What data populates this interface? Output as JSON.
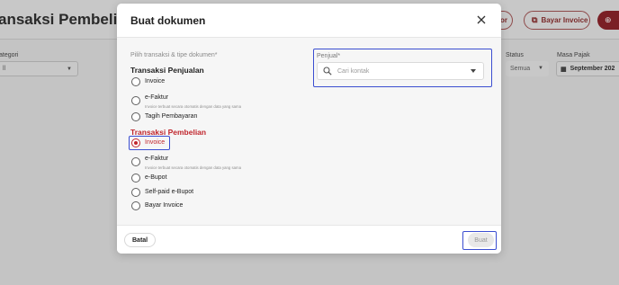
{
  "background": {
    "page_title": "ansaksi Pembelian",
    "header_buttons": {
      "partial_label": "or",
      "bayar_invoice_label": "Bayar Invoice"
    },
    "filters": {
      "kategori_label": "ategori",
      "kategori_value": "ll",
      "status_label": "Status",
      "status_value": "Semua",
      "masa_pajak_label": "Masa Pajak",
      "masa_pajak_value": "September 202"
    }
  },
  "modal": {
    "title": "Buat dokumen",
    "field_label": "Pilih transaksi & tipe dokumen*",
    "penjualan": {
      "heading": "Transaksi Penjualan",
      "options": [
        {
          "label": "Invoice",
          "desc": ""
        },
        {
          "label": "e-Faktur",
          "desc": "Invoice terbuat secara otomatis dengan data yang sama"
        },
        {
          "label": "Tagih Pembayaran",
          "desc": ""
        }
      ]
    },
    "pembelian": {
      "heading": "Transaksi Pembelian",
      "options": [
        {
          "label": "Invoice",
          "desc": "",
          "checked": true
        },
        {
          "label": "e-Faktur",
          "desc": "Invoice terbuat secara otomatis dengan data yang sama"
        },
        {
          "label": "e-Bupot",
          "desc": ""
        },
        {
          "label": "Self-paid e-Bupot",
          "desc": ""
        },
        {
          "label": "Bayar Invoice",
          "desc": ""
        }
      ]
    },
    "penjual": {
      "label": "Penjual*",
      "placeholder": "Cari kontak"
    },
    "footer": {
      "batal_label": "Batal",
      "buat_label": "Buat"
    }
  },
  "colors": {
    "accent_red": "#c0262d",
    "highlight_blue": "#3b4ed1",
    "overlay_gray": "#c4c4c4"
  }
}
